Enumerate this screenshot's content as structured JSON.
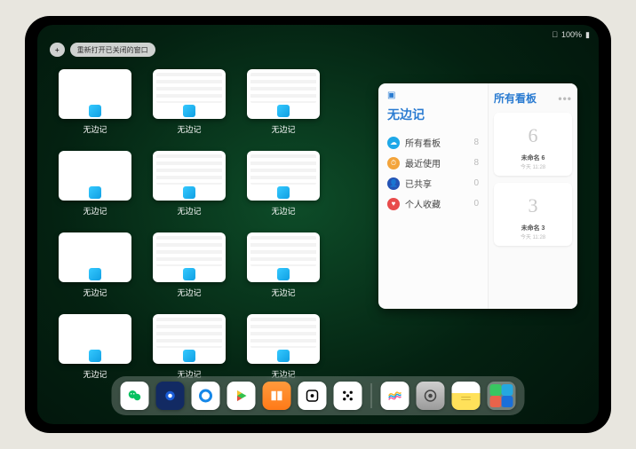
{
  "status": {
    "time": "",
    "battery": "100%"
  },
  "top": {
    "add": "+",
    "reopen": "重新打开已关闭的窗口"
  },
  "windows": [
    {
      "label": "无边记",
      "style": "plain"
    },
    {
      "label": "无边记",
      "style": "busy"
    },
    {
      "label": "无边记",
      "style": "busy"
    },
    {
      "label": "无边记",
      "style": "plain"
    },
    {
      "label": "无边记",
      "style": "busy"
    },
    {
      "label": "无边记",
      "style": "busy"
    },
    {
      "label": "无边记",
      "style": "plain"
    },
    {
      "label": "无边记",
      "style": "busy"
    },
    {
      "label": "无边记",
      "style": "busy"
    },
    {
      "label": "无边记",
      "style": "plain"
    },
    {
      "label": "无边记",
      "style": "busy"
    },
    {
      "label": "无边记",
      "style": "busy"
    }
  ],
  "panel": {
    "app": "无边记",
    "sidebar": [
      {
        "icon": "blue",
        "glyph": "☁",
        "label": "所有看板",
        "count": 8
      },
      {
        "icon": "orange",
        "glyph": "⏱",
        "label": "最近使用",
        "count": 8
      },
      {
        "icon": "navy",
        "glyph": "👤",
        "label": "已共享",
        "count": 0
      },
      {
        "icon": "red",
        "glyph": "♥",
        "label": "个人收藏",
        "count": 0
      }
    ],
    "rightTitle": "所有看板",
    "boards": [
      {
        "glyph": "6",
        "title": "未命名 6",
        "sub": "今天 11:28"
      },
      {
        "glyph": "3",
        "title": "未命名 3",
        "sub": "今天 11:28"
      }
    ]
  },
  "dock": [
    {
      "name": "wechat",
      "class": "app-wechat"
    },
    {
      "name": "search",
      "class": "app-search"
    },
    {
      "name": "browser",
      "class": "app-browser"
    },
    {
      "name": "play",
      "class": "app-play"
    },
    {
      "name": "books",
      "class": "app-books"
    },
    {
      "name": "dice",
      "class": "app-dice"
    },
    {
      "name": "hex",
      "class": "app-hex"
    },
    {
      "name": "sep"
    },
    {
      "name": "freeform",
      "class": "app-freeform"
    },
    {
      "name": "settings",
      "class": "app-settings"
    },
    {
      "name": "notes",
      "class": "app-notes"
    },
    {
      "name": "multi",
      "class": "app-multi"
    }
  ]
}
